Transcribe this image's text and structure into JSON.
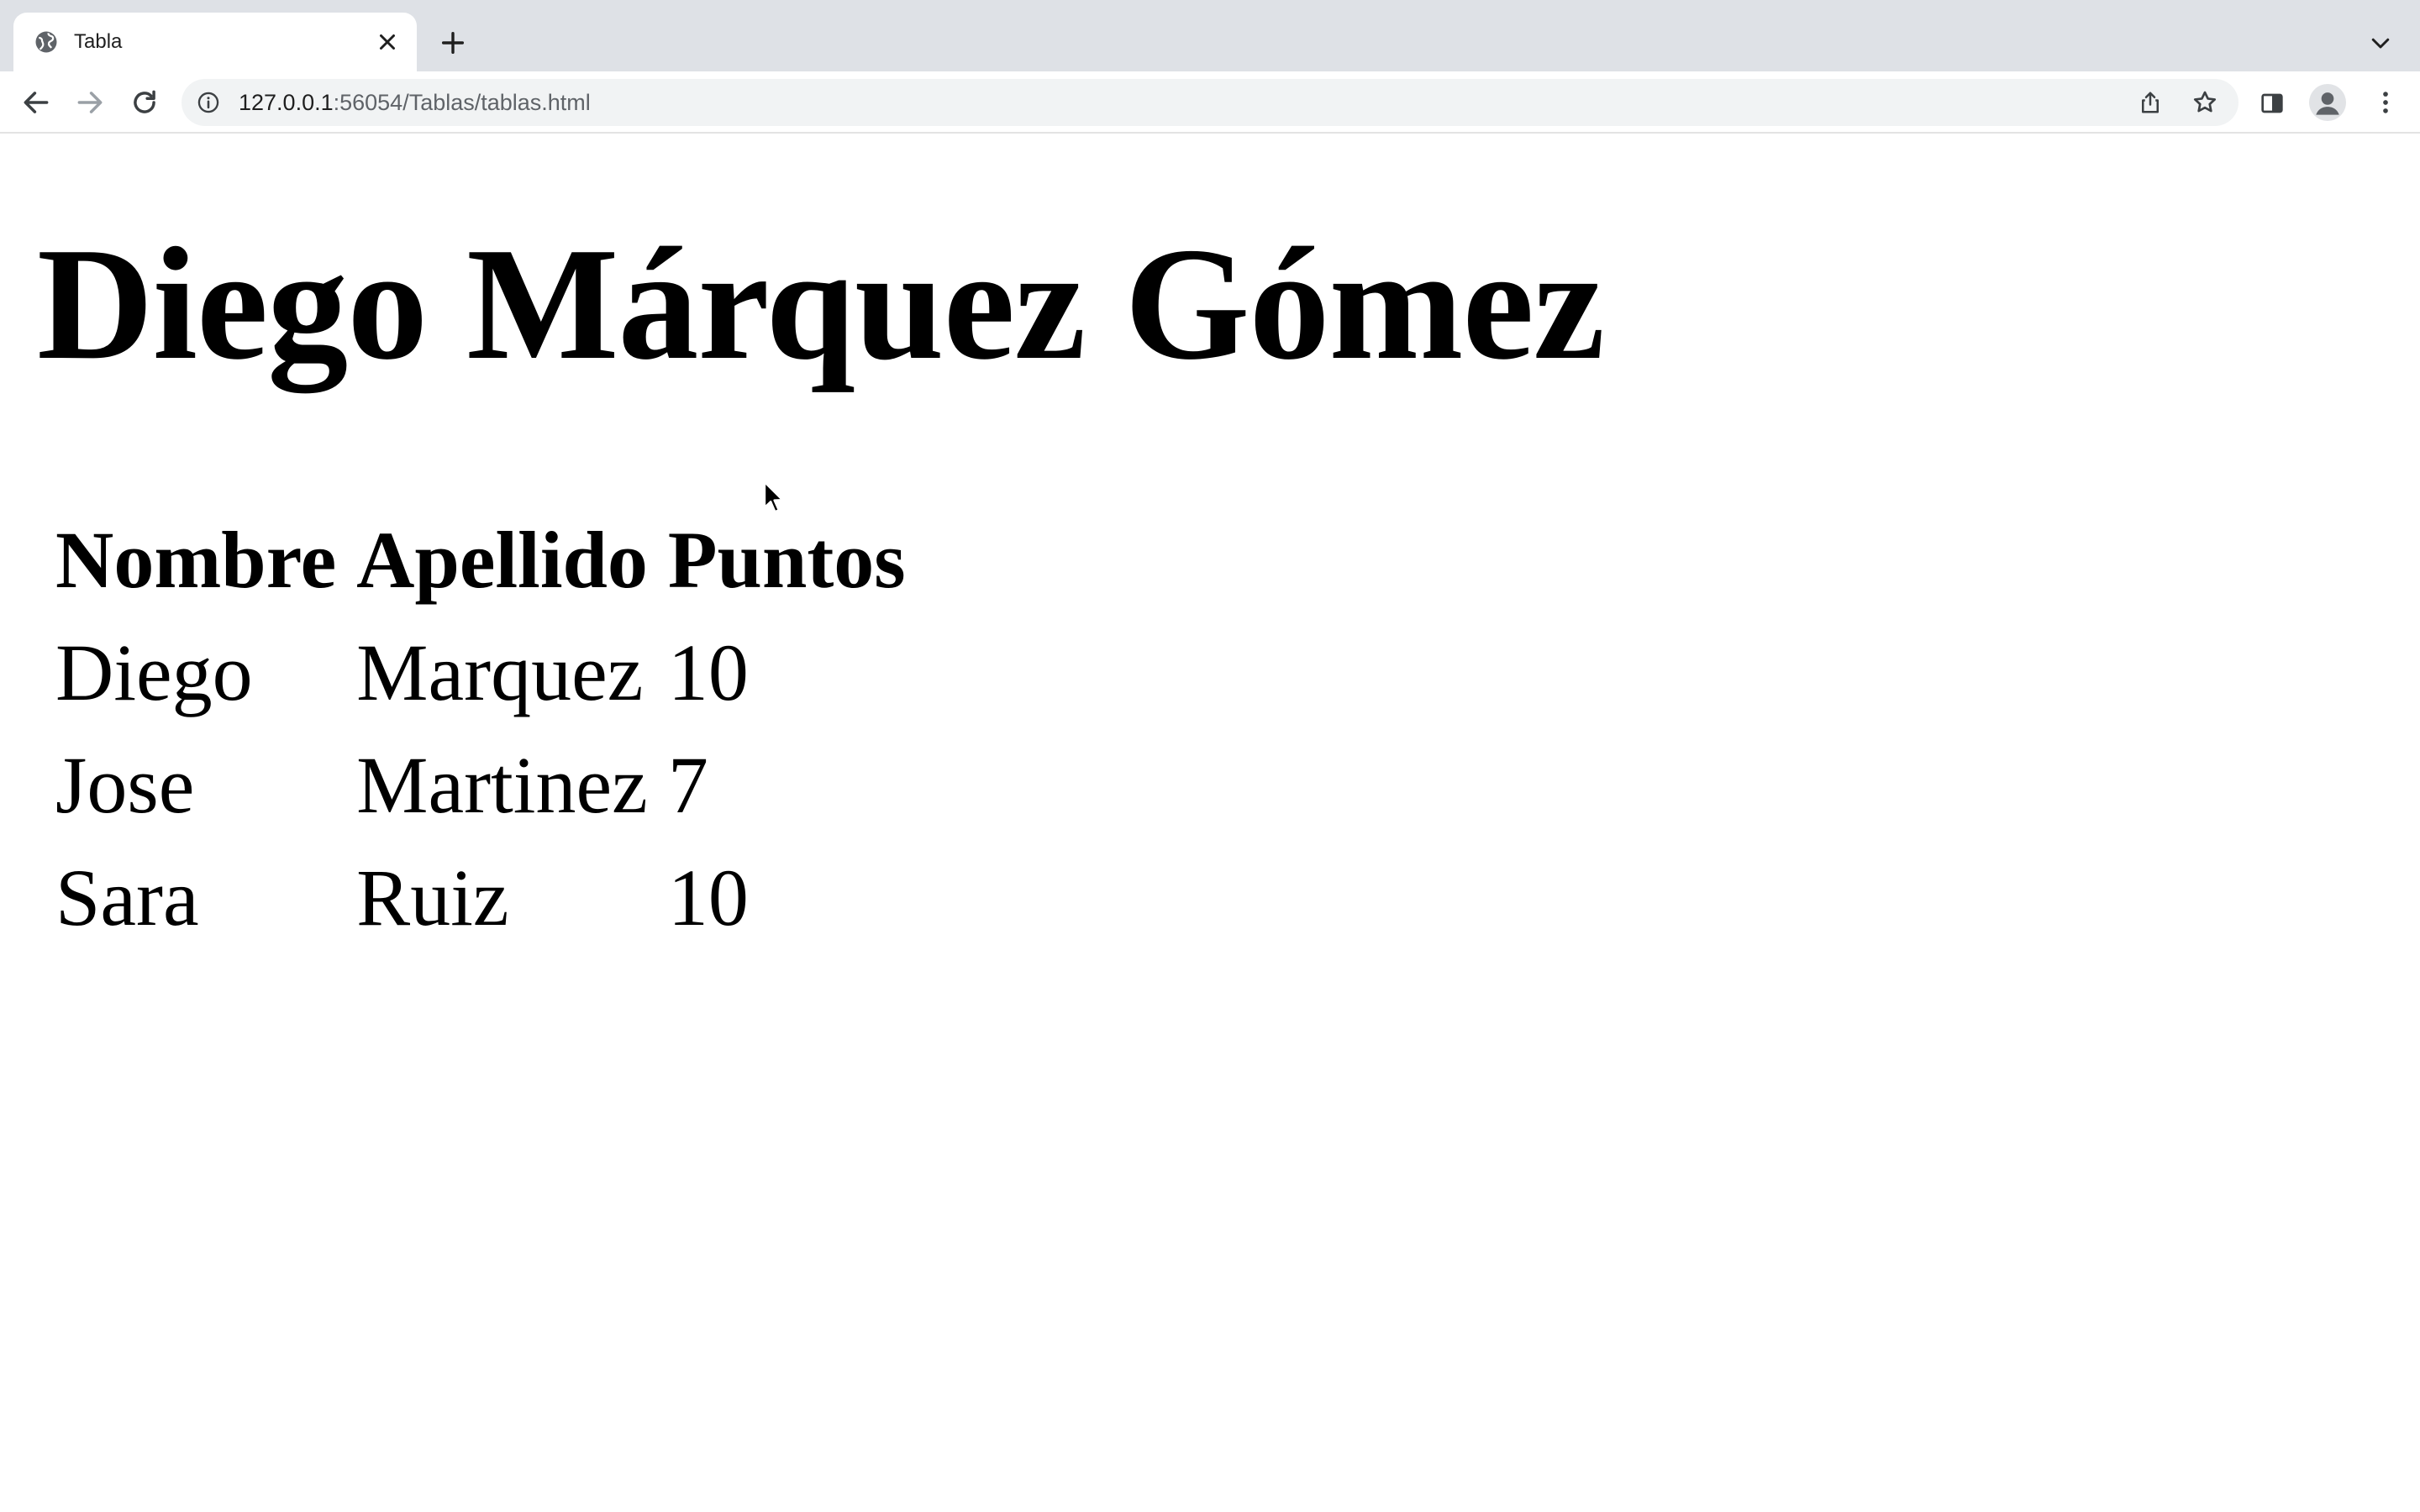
{
  "browser": {
    "tab": {
      "title": "Tabla",
      "favicon": "globe-icon",
      "close_icon": "close-icon"
    },
    "new_tab_icon": "plus-icon",
    "tab_search_icon": "chevron-down-icon",
    "nav": {
      "back_icon": "arrow-left-icon",
      "forward_icon": "arrow-right-icon",
      "reload_icon": "reload-icon"
    },
    "address": {
      "host": "127.0.0.1",
      "rest": ":56054/Tablas/tablas.html",
      "info_icon": "info-icon"
    },
    "actions": [
      "share-icon",
      "star-icon",
      "side-panel-icon",
      "profile-avatar",
      "kebab-menu-icon"
    ]
  },
  "page": {
    "heading": "Diego Márquez Gómez",
    "table": {
      "headers": [
        "Nombre",
        "Apellido",
        "Puntos"
      ],
      "rows": [
        [
          "Diego",
          "Marquez",
          "10"
        ],
        [
          "Jose",
          "Martinez",
          "7"
        ],
        [
          "Sara",
          "Ruiz",
          "10"
        ]
      ]
    }
  },
  "colors": {
    "tabstrip_bg": "#dee1e6",
    "omnibox_bg": "#f1f3f4",
    "icon": "#5f6368",
    "text": "#000000"
  }
}
